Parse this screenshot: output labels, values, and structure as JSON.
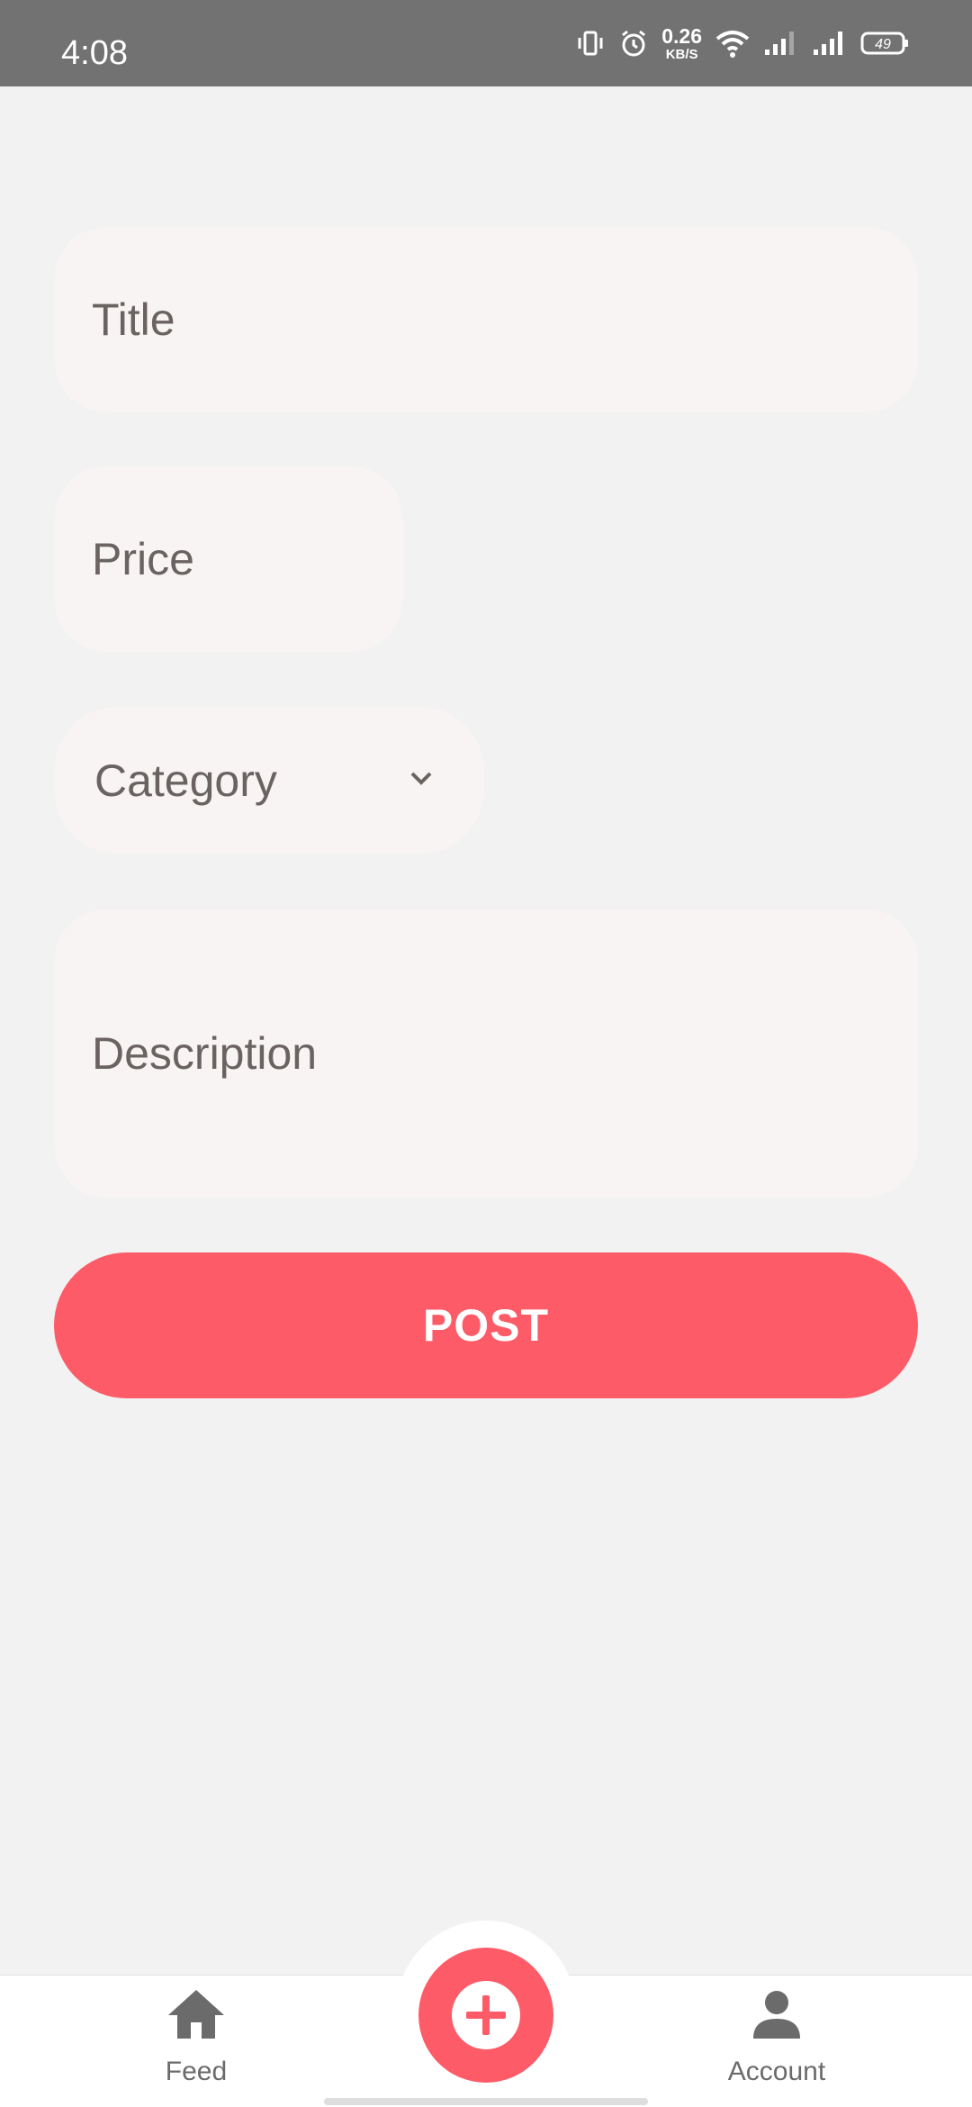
{
  "status_bar": {
    "time": "4:08",
    "net_speed_value": "0.26",
    "net_speed_unit": "KB/S",
    "battery": "49",
    "icons": [
      "vibrate-icon",
      "alarm-icon",
      "wifi-icon",
      "signal-icon",
      "signal-icon",
      "battery-icon"
    ]
  },
  "form": {
    "title_placeholder": "Title",
    "price_placeholder": "Price",
    "category_label": "Category",
    "description_placeholder": "Description",
    "post_label": "POST"
  },
  "bottom_nav": {
    "feed_label": "Feed",
    "account_label": "Account",
    "icons": [
      "home-icon",
      "plus-icon",
      "person-icon"
    ]
  },
  "colors": {
    "accent": "#fd5b67",
    "field_bg": "#f7f4f3",
    "page_bg": "#f2f2f2",
    "status_bar": "#727272"
  }
}
